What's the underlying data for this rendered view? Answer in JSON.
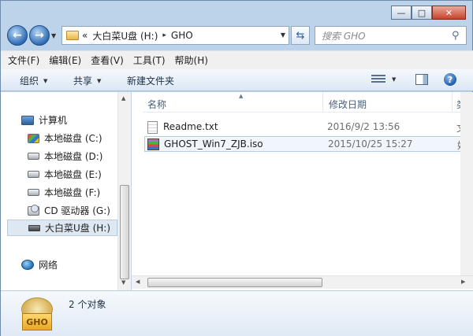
{
  "titlebar": {
    "minimize": "—",
    "maximize": "□",
    "close": "✕"
  },
  "address": {
    "crumb_prefix": "«",
    "drive": "大白菜U盘 (H:)",
    "separator": "▸",
    "folder": "GHO"
  },
  "search": {
    "placeholder": "搜索 GHO"
  },
  "menu": [
    "文件(F)",
    "编辑(E)",
    "查看(V)",
    "工具(T)",
    "帮助(H)"
  ],
  "toolbar": {
    "organize": "组织",
    "share": "共享",
    "new_folder": "新建文件夹"
  },
  "sidebar": {
    "computer": "计算机",
    "drives": [
      {
        "label": "本地磁盘 (C:)",
        "icon": "windows-drive-icon"
      },
      {
        "label": "本地磁盘 (D:)",
        "icon": "hard-drive-icon"
      },
      {
        "label": "本地磁盘 (E:)",
        "icon": "hard-drive-icon"
      },
      {
        "label": "本地磁盘 (F:)",
        "icon": "hard-drive-icon"
      },
      {
        "label": "CD 驱动器 (G:)",
        "icon": "cd-drive-icon"
      },
      {
        "label": "大白菜U盘 (H:)",
        "icon": "usb-drive-icon",
        "selected": true
      }
    ],
    "network": "网络"
  },
  "columns": {
    "name": "名称",
    "modified": "修改日期",
    "type": "类"
  },
  "files": [
    {
      "name": "Readme.txt",
      "modified": "2016/9/2 13:56",
      "type": "文",
      "icon": "text-file-icon"
    },
    {
      "name": "GHOST_Win7_ZJB.iso",
      "modified": "2015/10/25 15:27",
      "type": "好",
      "icon": "iso-archive-icon",
      "selected": true
    }
  ],
  "status": {
    "folder_icon_label": "GHO",
    "object_count": "2 个对象"
  }
}
